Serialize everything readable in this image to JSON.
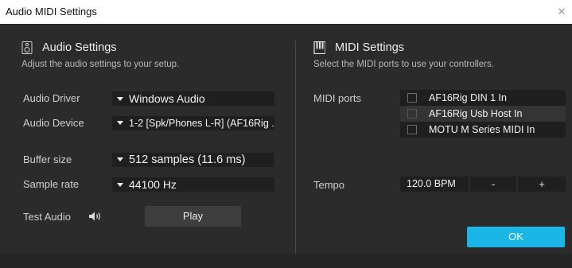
{
  "window": {
    "title": "Audio MIDI Settings",
    "close_glyph": "✕"
  },
  "audio": {
    "title": "Audio Settings",
    "icon": "speaker-icon",
    "hint": "Adjust the audio settings to your setup.",
    "driver_label": "Audio Driver",
    "driver_value": "Windows Audio",
    "device_label": "Audio Device",
    "device_value": "1-2 [Spk/Phones L-R] (AF16Rig ...",
    "buffer_label": "Buffer size",
    "buffer_value": "512 samples (11.6 ms)",
    "rate_label": "Sample rate",
    "rate_value": "44100 Hz",
    "test_label": "Test Audio",
    "test_icon": "volume-icon",
    "play_label": "Play"
  },
  "midi": {
    "title": "MIDI Settings",
    "icon": "piano-keys-icon",
    "hint": "Select the MIDI ports to use your controllers.",
    "ports_label": "MIDI ports",
    "ports": [
      {
        "name": "AF16Rig DIN 1 In",
        "checked": false,
        "selected": false
      },
      {
        "name": "AF16Rig Usb Host In",
        "checked": false,
        "selected": true
      },
      {
        "name": "MOTU M Series MIDI In",
        "checked": false,
        "selected": false
      }
    ],
    "tempo_label": "Tempo",
    "tempo_value": "120.0 BPM",
    "tempo_minus": "-",
    "tempo_plus": "+"
  },
  "ok_label": "OK",
  "colors": {
    "accent": "#1ab6e8",
    "background": "#2b2b2b",
    "field": "#1f1f1f"
  }
}
